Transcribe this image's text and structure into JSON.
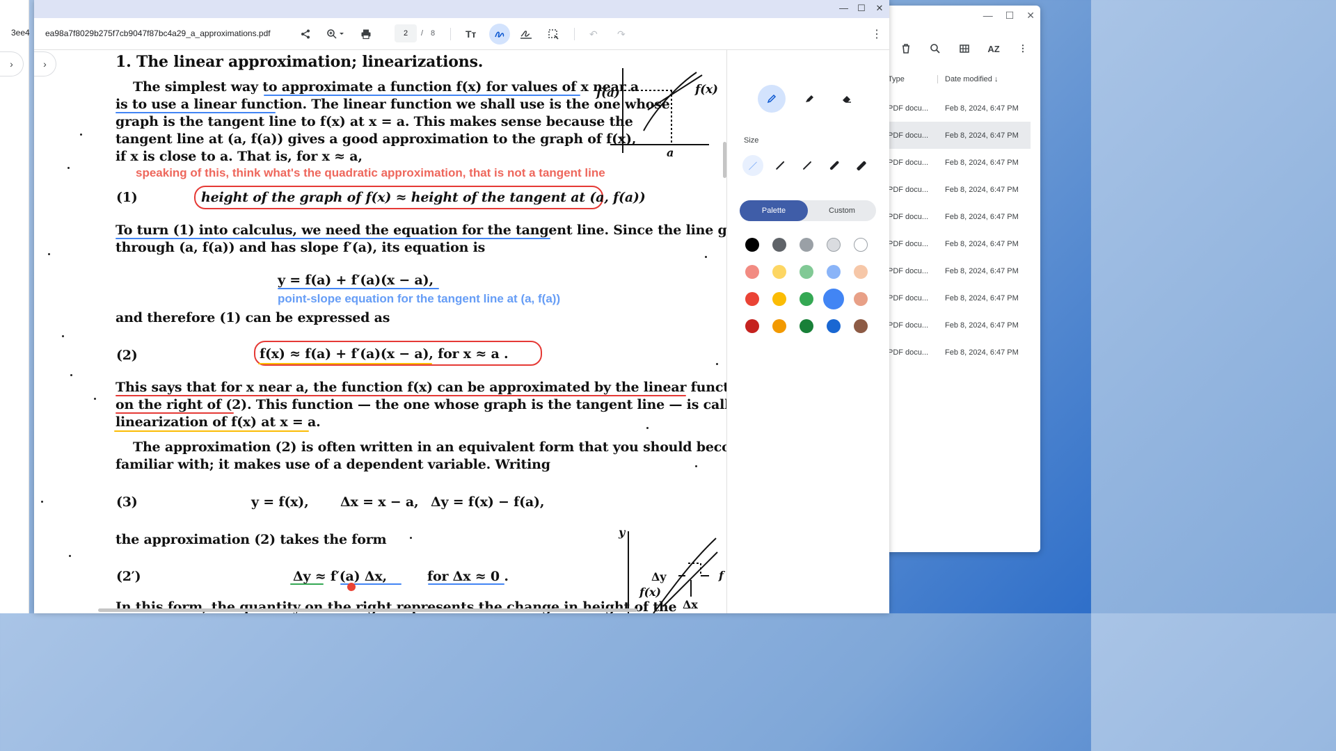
{
  "files_window": {
    "header_type": "Type",
    "header_date": "Date modified",
    "rows": [
      {
        "type": "PDF docu...",
        "date": "Feb 8, 2024, 6:47 PM"
      },
      {
        "type": "PDF docu...",
        "date": "Feb 8, 2024, 6:47 PM"
      },
      {
        "type": "PDF docu...",
        "date": "Feb 8, 2024, 6:47 PM"
      },
      {
        "type": "PDF docu...",
        "date": "Feb 8, 2024, 6:47 PM"
      },
      {
        "type": "PDF docu...",
        "date": "Feb 8, 2024, 6:47 PM"
      },
      {
        "type": "PDF docu...",
        "date": "Feb 8, 2024, 6:47 PM"
      },
      {
        "type": "PDF docu...",
        "date": "Feb 8, 2024, 6:47 PM"
      },
      {
        "type": "PDF docu...",
        "date": "Feb 8, 2024, 6:47 PM"
      },
      {
        "type": "PDF docu...",
        "date": "Feb 8, 2024, 6:47 PM"
      },
      {
        "type": "PDF docu...",
        "date": "Feb 8, 2024, 6:47 PM"
      }
    ],
    "toolbar_sort_label": "AZ"
  },
  "left_strip": {
    "fragment": "3ee4"
  },
  "viewer": {
    "filename": "ea98a7f8029b275f7cb9047f87bc4a29_a_approximations.pdf",
    "page_current": "2",
    "page_separator": "/",
    "page_total": "8"
  },
  "document": {
    "heading": "1. The linear approximation; linearizations.",
    "p1_l1": "The simplest way to approximate a function f(x) for values of x near a",
    "p1_l2": "is to use a linear function. The linear function we shall use is the one whose",
    "p1_l3": "graph is the tangent line to f(x) at x = a. This makes sense because the",
    "p1_l4": "tangent line at (a, f(a)) gives a good approximation to the graph of f(x),",
    "p1_l5": "if x is close to a. That is, for x ≈ a,",
    "annot1": "speaking of this, think what's the quadratic approximation, that is not a tangent line",
    "eq1_num": "(1)",
    "eq1": "height of the graph of f(x)  ≈ height of the tangent at (a, f(a))",
    "p2_l1": "To turn (1) into calculus, we need the equation for the tangent line.  Since the line goes",
    "p2_l2": "through (a, f(a)) and has slope f′(a), its equation is",
    "eq_tangent": "y  =  f(a) + f′(a)(x − a),",
    "annot2": "point-slope equation for the tangent line at (a, f(a))",
    "p3": "and therefore (1) can be expressed as",
    "eq2_num": "(2)",
    "eq2": "f(x)  ≈  f(a) + f′(a)(x − a),      for  x ≈ a .",
    "p4_l1": "This says that for x near a, the function f(x) can be approximated by the linear function",
    "p4_l2": "on the right of (2). This function — the one whose graph is the tangent line — is called the",
    "p4_l3": "linearization of f(x) at x = a.",
    "p5_l1": "The approximation (2) is often written in an equivalent form that you should become",
    "p5_l2": "familiar with; it makes use of a dependent variable. Writing",
    "eq3_num": "(3)",
    "eq3a": "y = f(x),",
    "eq3b": "Δx = x − a,",
    "eq3c": "Δy = f(x) − f(a),",
    "p6": "the approximation (2) takes the form",
    "eq2p_num": "(2′)",
    "eq2p_a": "Δy  ≈  f′(a) Δx,",
    "eq2p_b": "for Δx ≈ 0 .",
    "p7": "In this form, the quantity on the right represents the change in height of the",
    "fig1_fa": "f(a)",
    "fig1_fx": "f(x)",
    "fig1_a": "a",
    "fig2_y": "y",
    "fig2_dy": "Δy",
    "fig2_fx": "f(x)",
    "fig2_dx": "Δx",
    "fig2_f": "f"
  },
  "panel": {
    "size_label": "Size",
    "seg_palette": "Palette",
    "seg_custom": "Custom",
    "colors": [
      "#000000",
      "#5f6368",
      "#9aa0a6",
      "#dadce0",
      "#ffffff",
      "#f28b82",
      "#fdd663",
      "#81c995",
      "#8ab4f8",
      "#f6c7a8",
      "#ea4335",
      "#fbbc04",
      "#34a853",
      "#4285f4",
      "#e8a087",
      "#c5221f",
      "#f29900",
      "#188038",
      "#1967d2",
      "#8d5b45"
    ],
    "selected_color_index": 13
  }
}
